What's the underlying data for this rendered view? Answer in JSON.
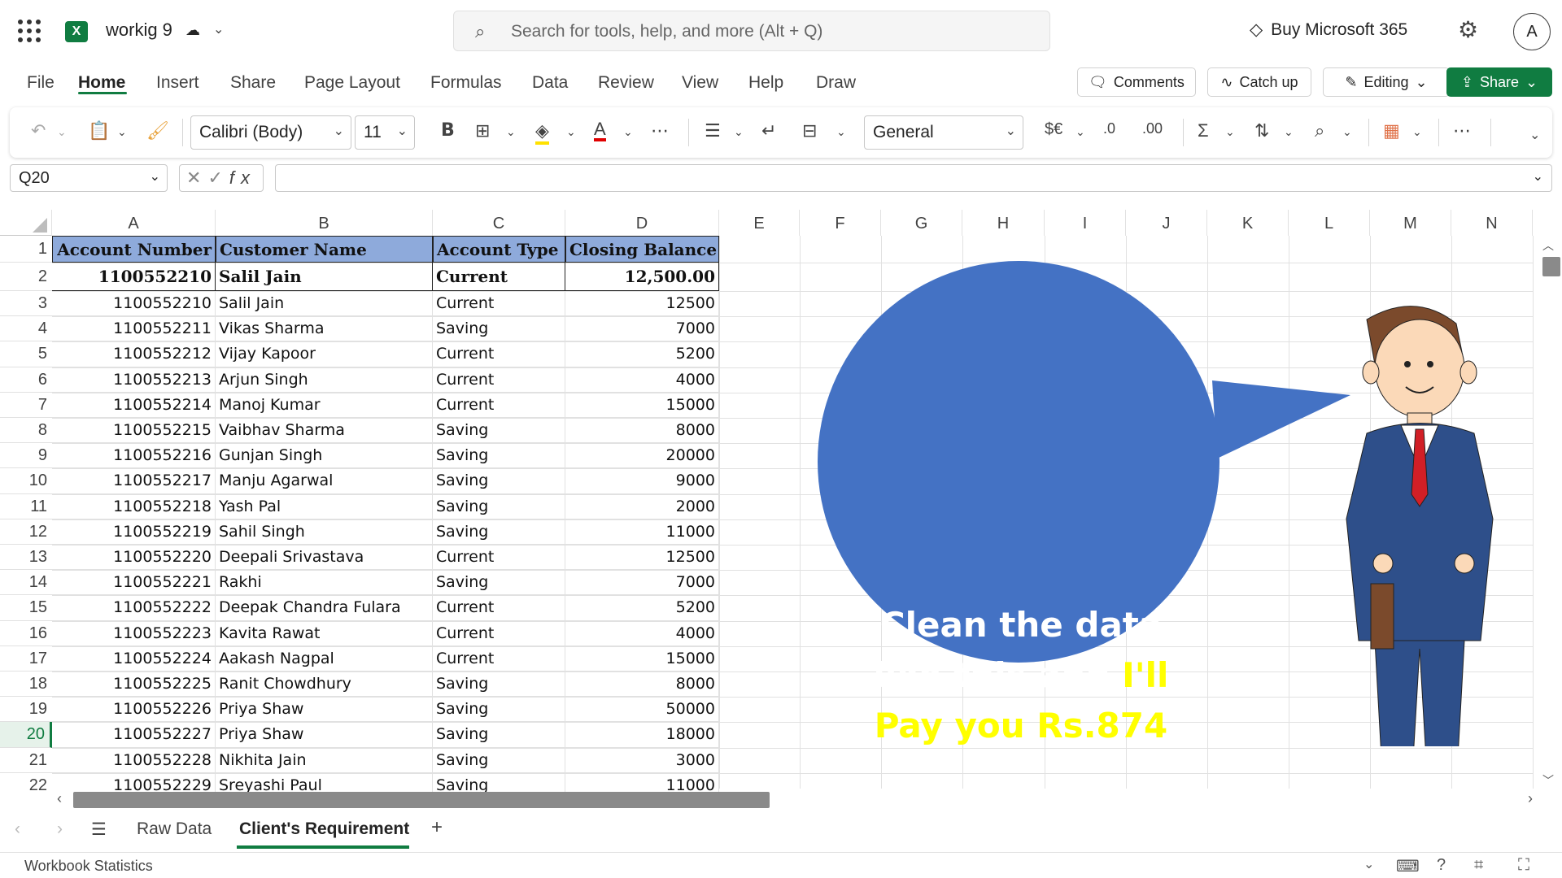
{
  "app": {
    "document_name": "workig 9",
    "search_placeholder": "Search for tools, help, and more (Alt + Q)",
    "buy_label": "Buy Microsoft 365",
    "avatar_initial": "A"
  },
  "menu": {
    "items": [
      "File",
      "Home",
      "Insert",
      "Share",
      "Page Layout",
      "Formulas",
      "Data",
      "Review",
      "View",
      "Help",
      "Draw"
    ],
    "active": "Home",
    "comments_label": "Comments",
    "catchup_label": "Catch up",
    "editing_label": "Editing",
    "share_label": "Share"
  },
  "ribbon": {
    "font_name": "Calibri (Body)",
    "font_size": "11",
    "number_format": "General"
  },
  "formula_bar": {
    "name_box": "Q20",
    "formula": ""
  },
  "columns": [
    "A",
    "B",
    "C",
    "D",
    "E",
    "F",
    "G",
    "H",
    "I",
    "J",
    "K",
    "L",
    "M",
    "N"
  ],
  "table": {
    "headers": [
      "Account Number",
      "Customer Name",
      "Account Type",
      "Closing Balance"
    ],
    "row2": [
      "1100552210",
      "Salil Jain",
      "Current",
      "12,500.00"
    ],
    "rows": [
      [
        "1100552210",
        "Salil Jain",
        "Current",
        "12500"
      ],
      [
        "1100552211",
        "Vikas Sharma",
        "Saving",
        "7000"
      ],
      [
        "1100552212",
        "Vijay Kapoor",
        "Current",
        "5200"
      ],
      [
        "1100552213",
        "Arjun Singh",
        "Current",
        "4000"
      ],
      [
        "1100552214",
        "Manoj Kumar",
        "Current",
        "15000"
      ],
      [
        "1100552215",
        "Vaibhav Sharma",
        "Saving",
        "8000"
      ],
      [
        "1100552216",
        "Gunjan Singh",
        "Saving",
        "20000"
      ],
      [
        "1100552217",
        "Manju Agarwal",
        "Saving",
        "9000"
      ],
      [
        "1100552218",
        "Yash Pal",
        "Saving",
        "2000"
      ],
      [
        "1100552219",
        "Sahil Singh",
        "Saving",
        "11000"
      ],
      [
        "1100552220",
        "Deepali Srivastava",
        "Current",
        "12500"
      ],
      [
        "1100552221",
        "Rakhi",
        "Saving",
        "7000"
      ],
      [
        "1100552222",
        "Deepak Chandra Fulara",
        "Current",
        "5200"
      ],
      [
        "1100552223",
        "Kavita Rawat",
        "Current",
        "4000"
      ],
      [
        "1100552224",
        "Aakash Nagpal",
        "Current",
        "15000"
      ],
      [
        "1100552225",
        "Ranit Chowdhury",
        "Saving",
        "8000"
      ],
      [
        "1100552226",
        "Priya Shaw",
        "Saving",
        "50000"
      ],
      [
        "1100552227",
        "Priya Shaw",
        "Saving",
        "18000"
      ],
      [
        "1100552228",
        "Nikhita Jain",
        "Saving",
        "3000"
      ],
      [
        "1100552229",
        "Sreyashi Paul",
        "Saving",
        "11000"
      ]
    ]
  },
  "row_numbers": [
    "1",
    "2",
    "3",
    "4",
    "5",
    "6",
    "7",
    "8",
    "9",
    "10",
    "11",
    "12",
    "13",
    "14",
    "15",
    "16",
    "17",
    "18",
    "19",
    "20",
    "21",
    "22"
  ],
  "active_row": "20",
  "callout": {
    "line1": "Clean the data",
    "line2a": "like this and ",
    "line2b": "I'll",
    "line3": "Pay you Rs.874"
  },
  "sheets": {
    "tabs": [
      "Raw Data",
      "Client's Requirement"
    ],
    "active": "Client's Requirement"
  },
  "status": {
    "text": "Workbook Statistics"
  },
  "colors": {
    "accent": "#107c41",
    "header_fill": "#8eaadb",
    "bubble": "#4472c4",
    "highlight_text": "#ffff00"
  }
}
